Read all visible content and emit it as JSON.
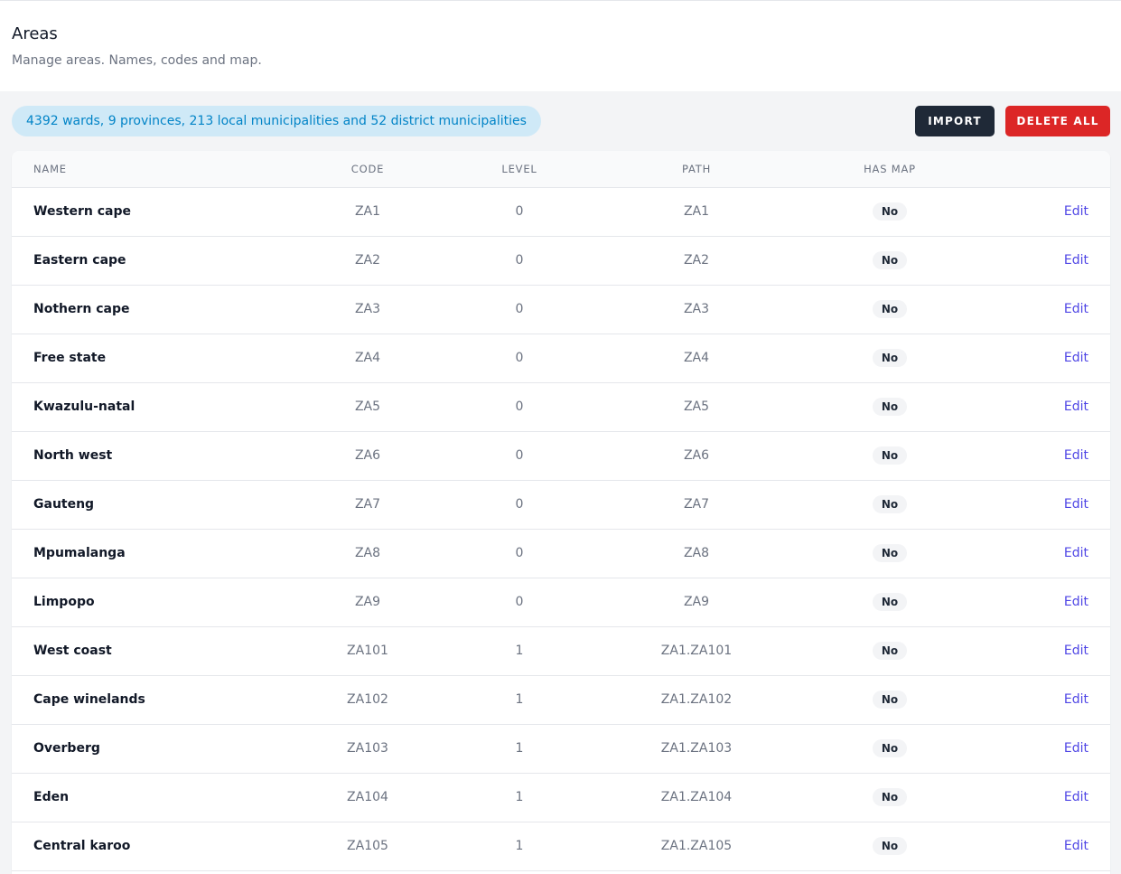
{
  "page": {
    "title": "Areas",
    "subtitle": "Manage areas. Names, codes and map."
  },
  "summary": {
    "text": "4392 wards, 9 provinces, 213 local municipalities and 52 district municipalities"
  },
  "toolbar": {
    "import_label": "IMPORT",
    "delete_all_label": "DELETE ALL"
  },
  "colors": {
    "import_button": "#1f2937",
    "delete_button": "#dc2626",
    "summary_bg": "#cfe9f7",
    "summary_text": "#0284c7",
    "edit_link": "#4f46e5"
  },
  "table": {
    "headers": {
      "name": "Name",
      "code": "Code",
      "level": "Level",
      "path": "Path",
      "has_map": "Has map"
    },
    "rows": [
      {
        "name": "Western cape",
        "code": "ZA1",
        "level": "0",
        "path": "ZA1",
        "has_map": "No",
        "action": "Edit"
      },
      {
        "name": "Eastern cape",
        "code": "ZA2",
        "level": "0",
        "path": "ZA2",
        "has_map": "No",
        "action": "Edit"
      },
      {
        "name": "Nothern cape",
        "code": "ZA3",
        "level": "0",
        "path": "ZA3",
        "has_map": "No",
        "action": "Edit"
      },
      {
        "name": "Free state",
        "code": "ZA4",
        "level": "0",
        "path": "ZA4",
        "has_map": "No",
        "action": "Edit"
      },
      {
        "name": "Kwazulu-natal",
        "code": "ZA5",
        "level": "0",
        "path": "ZA5",
        "has_map": "No",
        "action": "Edit"
      },
      {
        "name": "North west",
        "code": "ZA6",
        "level": "0",
        "path": "ZA6",
        "has_map": "No",
        "action": "Edit"
      },
      {
        "name": "Gauteng",
        "code": "ZA7",
        "level": "0",
        "path": "ZA7",
        "has_map": "No",
        "action": "Edit"
      },
      {
        "name": "Mpumalanga",
        "code": "ZA8",
        "level": "0",
        "path": "ZA8",
        "has_map": "No",
        "action": "Edit"
      },
      {
        "name": "Limpopo",
        "code": "ZA9",
        "level": "0",
        "path": "ZA9",
        "has_map": "No",
        "action": "Edit"
      },
      {
        "name": "West coast",
        "code": "ZA101",
        "level": "1",
        "path": "ZA1.ZA101",
        "has_map": "No",
        "action": "Edit"
      },
      {
        "name": "Cape winelands",
        "code": "ZA102",
        "level": "1",
        "path": "ZA1.ZA102",
        "has_map": "No",
        "action": "Edit"
      },
      {
        "name": "Overberg",
        "code": "ZA103",
        "level": "1",
        "path": "ZA1.ZA103",
        "has_map": "No",
        "action": "Edit"
      },
      {
        "name": "Eden",
        "code": "ZA104",
        "level": "1",
        "path": "ZA1.ZA104",
        "has_map": "No",
        "action": "Edit"
      },
      {
        "name": "Central karoo",
        "code": "ZA105",
        "level": "1",
        "path": "ZA1.ZA105",
        "has_map": "No",
        "action": "Edit"
      }
    ]
  }
}
